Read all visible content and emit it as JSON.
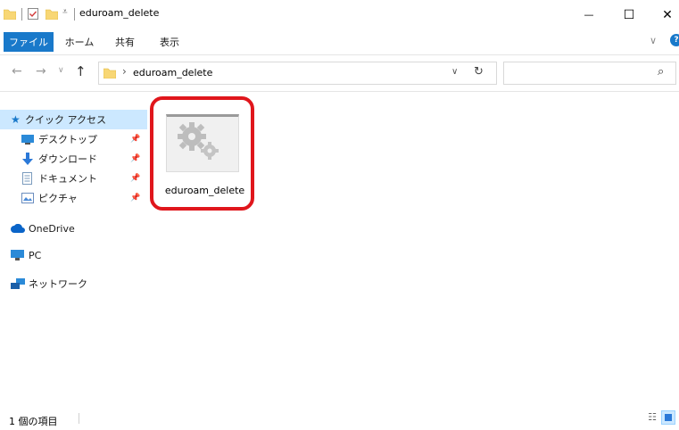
{
  "window": {
    "title": "eduroam_delete",
    "minimize_glyph": "—",
    "maximize_glyph": "☐",
    "close_glyph": "✕"
  },
  "ribbon": {
    "tabs": [
      "ファイル",
      "ホーム",
      "共有",
      "表示"
    ],
    "expand_glyph": "∨",
    "help_glyph": "?"
  },
  "address": {
    "path_segment": "eduroam_delete",
    "separator": "›",
    "dropdown_glyph": "∨",
    "refresh_glyph": "↻",
    "search_placeholder": "",
    "search_glyph": "⌕"
  },
  "nav": {
    "back_glyph": "←",
    "forward_glyph": "→",
    "recent_glyph": "∨",
    "up_glyph": "↑",
    "quick_access": "クイック アクセス",
    "items": [
      {
        "label": "デスクトップ",
        "icon": "desktop-icon",
        "pinned": true
      },
      {
        "label": "ダウンロード",
        "icon": "download-icon",
        "pinned": true
      },
      {
        "label": "ドキュメント",
        "icon": "document-icon",
        "pinned": true
      },
      {
        "label": "ピクチャ",
        "icon": "pictures-icon",
        "pinned": true
      }
    ],
    "onedrive": "OneDrive",
    "pc": "PC",
    "network": "ネットワーク"
  },
  "files": [
    {
      "name": "eduroam_delete",
      "icon": "application-gears-icon",
      "highlighted": true
    }
  ],
  "status": {
    "item_count": "1 個の項目"
  },
  "colors": {
    "accent": "#1979ca",
    "highlight": "#e0161c",
    "folder": "#f8d775"
  }
}
